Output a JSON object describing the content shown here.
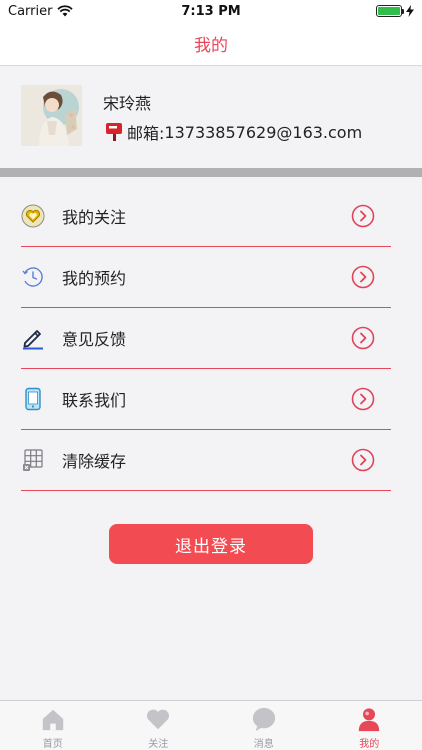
{
  "status_bar": {
    "carrier": "Carrier",
    "time": "7:13 PM"
  },
  "nav": {
    "title": "我的"
  },
  "profile": {
    "name": "宋玲燕",
    "email_prefix": "邮箱:",
    "email": "13733857629@163.com"
  },
  "menu": [
    {
      "label": "我的关注",
      "icon": "heart-badge-icon"
    },
    {
      "label": "我的预约",
      "icon": "clock-icon"
    },
    {
      "label": "意见反馈",
      "icon": "pencil-icon"
    },
    {
      "label": "联系我们",
      "icon": "phone-icon"
    },
    {
      "label": "清除缓存",
      "icon": "grid-trash-icon"
    }
  ],
  "logout": {
    "label": "退出登录"
  },
  "tabs": [
    {
      "label": "首页",
      "icon": "home-icon",
      "active": false
    },
    {
      "label": "关注",
      "icon": "heart-icon",
      "active": false
    },
    {
      "label": "消息",
      "icon": "chat-bubble-icon",
      "active": false
    },
    {
      "label": "我的",
      "icon": "person-icon",
      "active": true
    }
  ],
  "colors": {
    "accent": "#e8475a",
    "logout_bg": "#f34b52",
    "divider_gray": "#b1b1b1"
  }
}
